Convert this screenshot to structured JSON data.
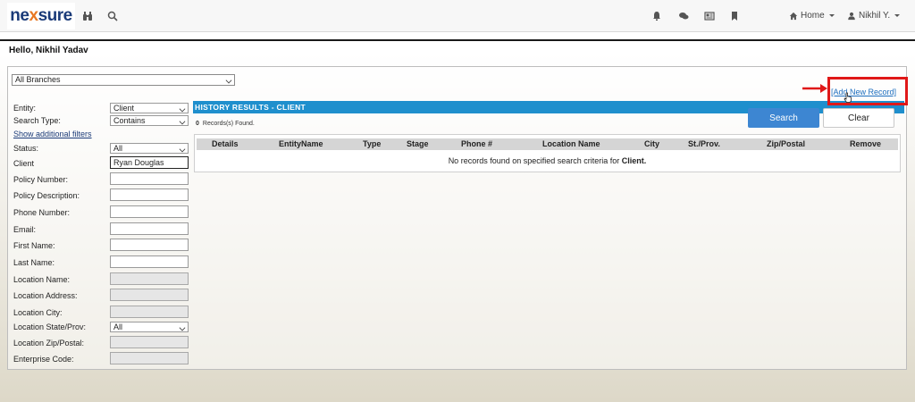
{
  "nav": {
    "logo_pre": "ne",
    "logo_x": "x",
    "logo_post": "sure",
    "home_label": "Home",
    "user_label": "Nikhil Y."
  },
  "greeting": "Hello, Nikhil Yadav",
  "branch_select": "All Branches",
  "form": {
    "entity_label": "Entity:",
    "entity_value": "Client",
    "search_type_label": "Search Type:",
    "search_type_value": "Contains",
    "show_filters_label": "Show additional filters",
    "status_label": "Status:",
    "status_value": "All",
    "client_label": "Client",
    "client_value": "Ryan Douglas",
    "policy_number_label": "Policy Number:",
    "policy_description_label": "Policy Description:",
    "phone_number_label": "Phone Number:",
    "email_label": "Email:",
    "first_name_label": "First Name:",
    "last_name_label": "Last Name:",
    "location_name_label": "Location Name:",
    "location_address_label": "Location Address:",
    "location_city_label": "Location City:",
    "location_state_label": "Location State/Prov:",
    "location_state_value": "All",
    "location_zip_label": "Location Zip/Postal:",
    "enterprise_code_label": "Enterprise Code:"
  },
  "results": {
    "header": "HISTORY RESULTS - CLIENT",
    "records_count": "0",
    "records_text": "Records(s) Found.",
    "columns": [
      "Details",
      "EntityName",
      "Type",
      "Stage",
      "Phone #",
      "Location Name",
      "City",
      "St./Prov.",
      "Zip/Postal",
      "Remove"
    ],
    "no_records_text": "No records found on specified search criteria for ",
    "no_records_entity": "Client."
  },
  "buttons": {
    "search": "Search",
    "clear": "Clear"
  },
  "add_new_record": "[Add New Record]",
  "colors": {
    "header_blue": "#1f8fcd",
    "search_button": "#3d86d2",
    "highlight_red": "#e01818",
    "logo_navy": "#1a3a78",
    "logo_orange": "#e87722"
  }
}
